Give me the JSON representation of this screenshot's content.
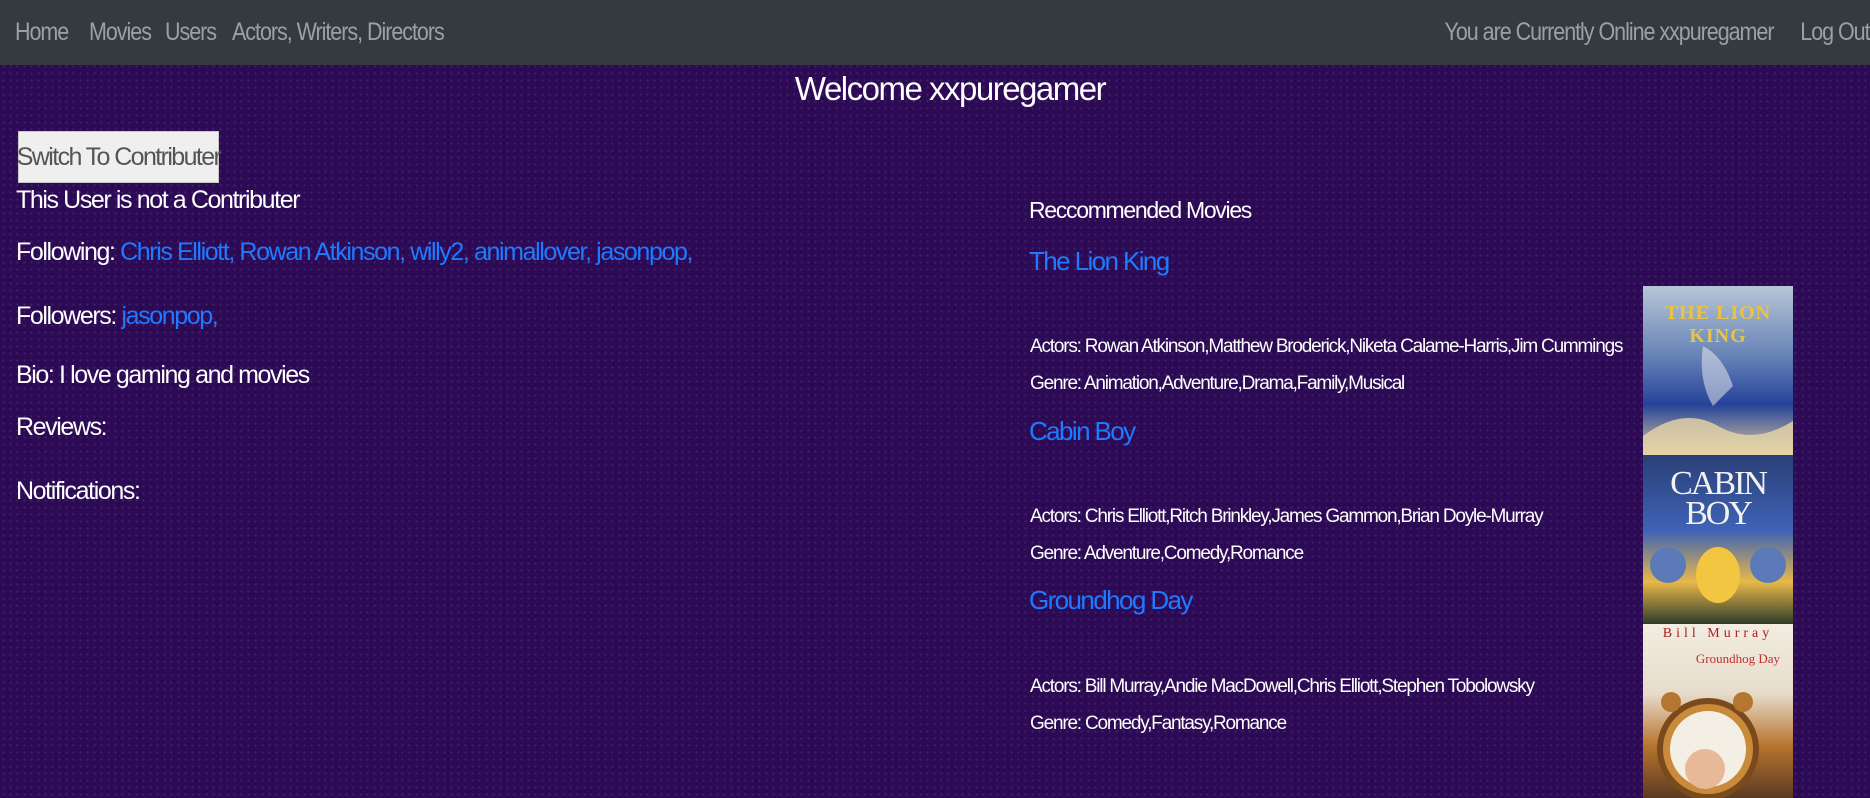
{
  "nav": {
    "links": [
      "Home",
      "Movies",
      "Users",
      "Actors, Writers, Directors"
    ],
    "online_text": "You are Currently Online xxpuregamer",
    "logout": "Log Out"
  },
  "welcome": "Welcome xxpuregamer",
  "switch_button": "Switch To Contributer",
  "profile": {
    "contributor_status": "This User is not a Contributer",
    "following_label": "Following:",
    "following": [
      "Chris Elliott,",
      "Rowan Atkinson,",
      "willy2,",
      "animallover,",
      "jasonpop,"
    ],
    "followers_label": "Followers:",
    "followers": [
      "jasonpop,"
    ],
    "bio": "Bio: I love gaming and movies",
    "reviews_label": "Reviews:",
    "notifications_label": "Notifications:"
  },
  "recommended": {
    "heading": "Reccommended Movies",
    "movies": [
      {
        "title": "The Lion King",
        "actors": "Actors: Rowan Atkinson,Matthew Broderick,Niketa Calame-Harris,Jim Cummings",
        "genre": "Genre: Animation,Adventure,Drama,Family,Musical",
        "poster_text": "THE LION KING"
      },
      {
        "title": "Cabin Boy",
        "actors": "Actors: Chris Elliott,Ritch Brinkley,James Gammon,Brian Doyle-Murray",
        "genre": "Genre: Adventure,Comedy,Romance",
        "poster_text": "CABIN BOY"
      },
      {
        "title": "Groundhog Day",
        "actors": "Actors: Bill Murray,Andie MacDowell,Chris Elliott,Stephen Tobolowsky",
        "genre": "Genre: Comedy,Fantasy,Romance",
        "poster_text": "Groundhog Day",
        "poster_actor": "Bill Murray"
      }
    ]
  }
}
